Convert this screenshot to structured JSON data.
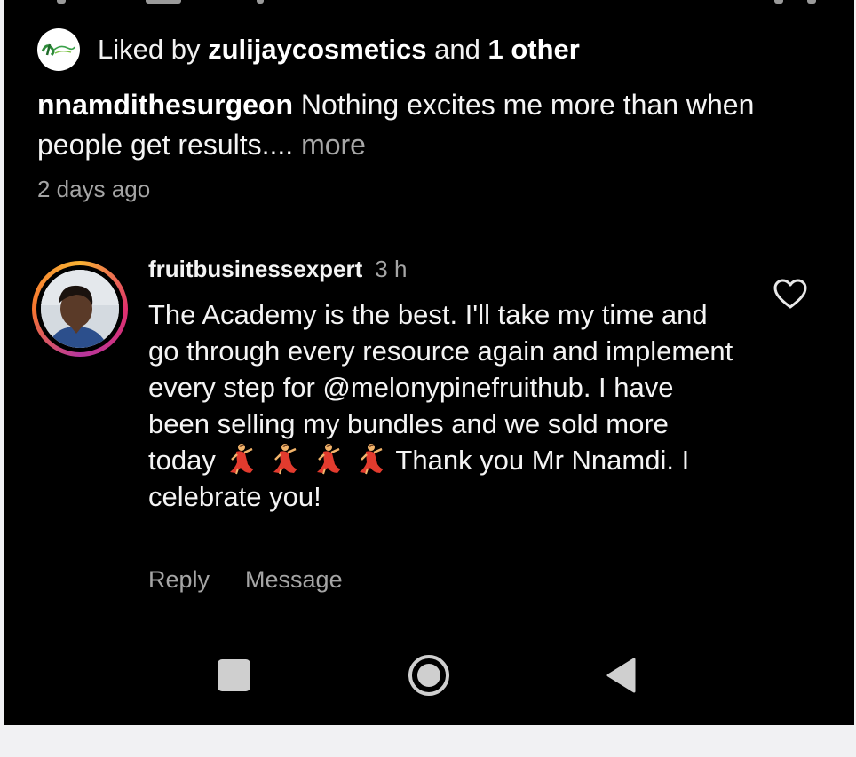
{
  "liked": {
    "prefix": "Liked by",
    "user": "zulijaycosmetics",
    "connector": "and",
    "others": "1 other",
    "avatar_icon": "zulijay-logo-avatar"
  },
  "post": {
    "author": "nnamdithesurgeon",
    "caption": "Nothing excites me more than when people get results....",
    "more": "more",
    "time": "2 days ago"
  },
  "comment": {
    "username": "fruitbusinessexpert",
    "time": "3 h",
    "text_before_emoji": "The Academy is the best. I'll take my time and go through every resource again and implement every step for @melonypinefruithub. I have been selling my bundles and we sold more today",
    "text_after_emoji": "Thank you Mr Nnamdi. I celebrate you!",
    "emoji_name": "woman-dancing-emoji",
    "emoji_count": 4,
    "like_icon": "heart-outline-icon",
    "reply_label": "Reply",
    "message_label": "Message",
    "avatar_ring_colors": [
      "#f9b233",
      "#e0306d",
      "#b6369e",
      "#f7752f"
    ]
  },
  "navbar": {
    "recents_icon": "square-recents-icon",
    "home_icon": "circle-home-icon",
    "back_icon": "triangle-back-icon"
  },
  "colors": {
    "background": "#000000",
    "text_primary": "#f4f4f4",
    "text_secondary": "#a5a5a5",
    "outer_background": "#f1f1f3"
  }
}
